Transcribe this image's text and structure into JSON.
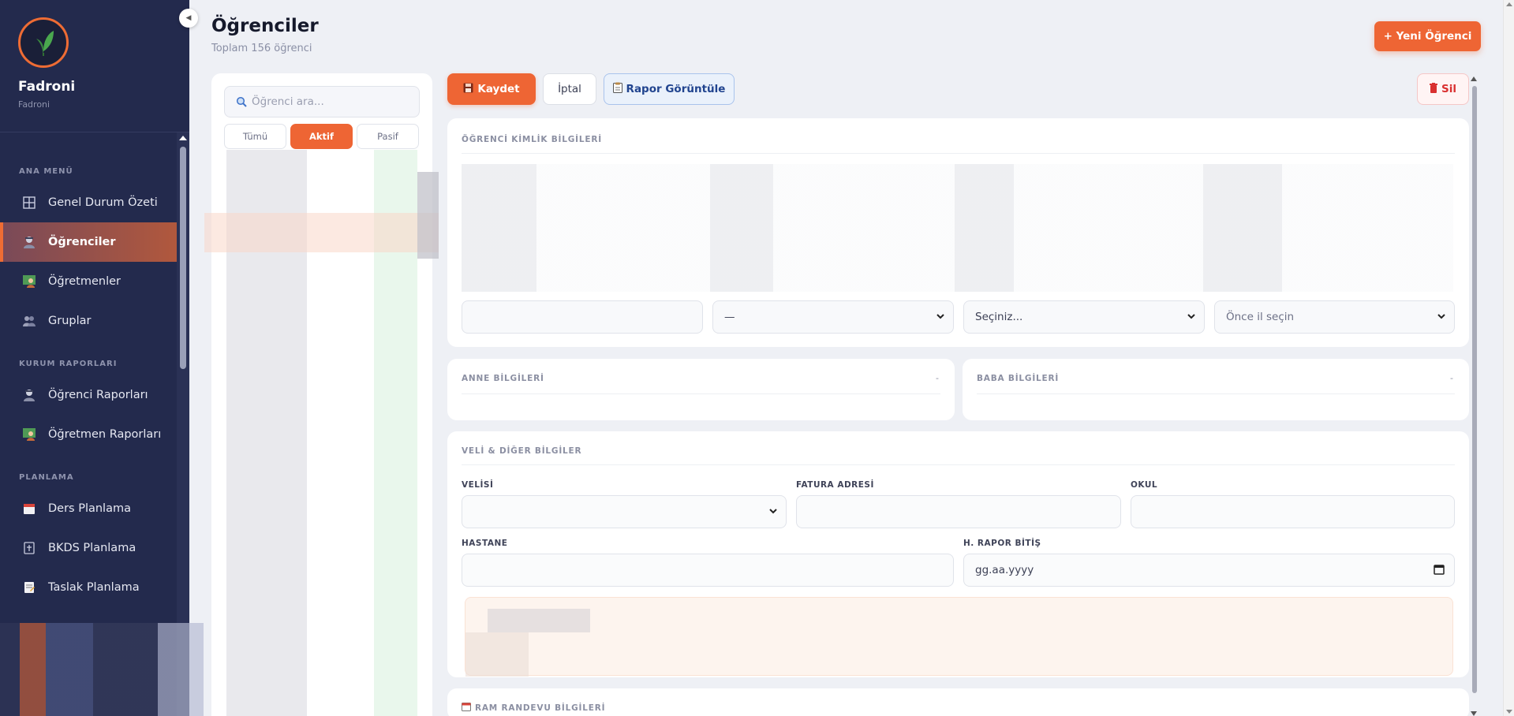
{
  "app": {
    "brand_name": "Fadroni",
    "brand_sub": "Fadroni",
    "collapse_glyph": "◀"
  },
  "sidebar": {
    "sections": [
      {
        "label": "ANA MENÜ"
      },
      {
        "label": "KURUM RAPORLARI"
      },
      {
        "label": "PLANLAMA"
      }
    ],
    "items": [
      {
        "label": "Genel Durum Özeti",
        "icon": "dashboard-grid-icon"
      },
      {
        "label": "Öğrenciler",
        "icon": "student-icon",
        "active": true
      },
      {
        "label": "Öğretmenler",
        "icon": "teacher-icon"
      },
      {
        "label": "Gruplar",
        "icon": "group-icon"
      },
      {
        "label": "Öğrenci Raporları",
        "icon": "student-report-icon"
      },
      {
        "label": "Öğretmen Raporları",
        "icon": "teacher-report-icon"
      },
      {
        "label": "Ders Planlama",
        "icon": "calendar-icon"
      },
      {
        "label": "BKDS Planlama",
        "icon": "id-card-icon"
      },
      {
        "label": "Taslak Planlama",
        "icon": "draft-icon"
      }
    ]
  },
  "header": {
    "title": "Öğrenciler",
    "subtitle": "Toplam 156 öğrenci",
    "new_button": "+ Yeni Öğrenci"
  },
  "list": {
    "search_placeholder": "Öğrenci ara...",
    "filters": [
      {
        "label": "Tümü"
      },
      {
        "label": "Aktif",
        "active": true
      },
      {
        "label": "Pasif"
      }
    ]
  },
  "toolbar": {
    "save": "Kaydet",
    "cancel": "İptal",
    "report": "Rapor Görüntüle",
    "delete": "Sil"
  },
  "identity": {
    "title": "ÖĞRENCİ KİMLİK BİLGİLERİ",
    "select_dash": "—",
    "select_choose": "Seçiniz...",
    "select_city_first": "Önce il seçin"
  },
  "anne": {
    "title": "ANNE BİLGİLERİ",
    "dash": "-"
  },
  "baba": {
    "title": "BABA BİLGİLERİ",
    "dash": "-"
  },
  "veli": {
    "title": "VELİ & DİĞER BİLGİLER",
    "velisi": "VELİSİ",
    "fatura": "FATURA ADRESİ",
    "okul": "OKUL",
    "hastane": "HASTANE",
    "rapor_bitis": "H. RAPOR BİTİŞ",
    "date_placeholder": "gg.aa.yyyy"
  },
  "ram": {
    "title": "RAM RANDEVU BİLGİLERİ"
  },
  "colors": {
    "accent": "#ee6534",
    "sidebar": "#232a4d",
    "danger": "#d93030",
    "info": "#21448f"
  }
}
